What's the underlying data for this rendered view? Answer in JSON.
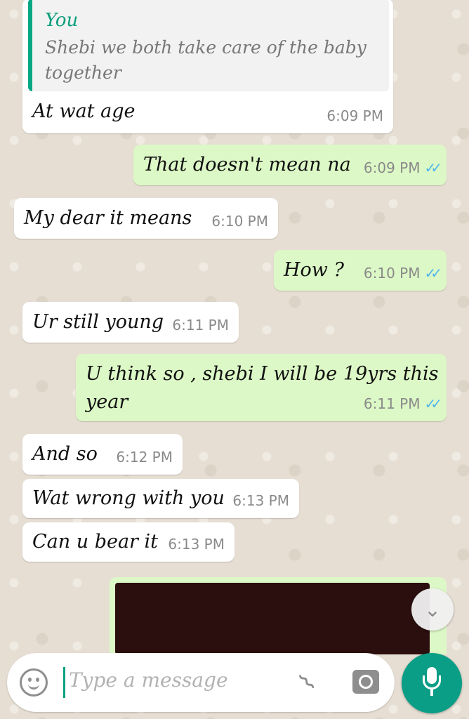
{
  "messages": [
    {
      "kind": "in",
      "text": "At wat age",
      "time": "6:09 PM",
      "reply": {
        "author": "You",
        "text": "Shebi we both take care of the baby together"
      }
    },
    {
      "kind": "out",
      "text": "That doesn't mean na",
      "time": "6:09 PM",
      "ticks": "✓✓"
    },
    {
      "kind": "in",
      "text": "My dear it means",
      "time": "6:10 PM"
    },
    {
      "kind": "out",
      "text": "How ?",
      "time": "6:10 PM",
      "ticks": "✓✓"
    },
    {
      "kind": "in",
      "text": "Ur still young",
      "time": "6:11 PM"
    },
    {
      "kind": "out",
      "text": "U think so , shebi I will be 19yrs this year",
      "line1": "U think so , shebi I will be 19yrs this",
      "line2": "year",
      "time": "6:11 PM",
      "ticks": "✓✓"
    },
    {
      "kind": "in",
      "text": "And so",
      "time": "6:12 PM"
    },
    {
      "kind": "in",
      "text": "Wat wrong with you",
      "time": "6:13 PM"
    },
    {
      "kind": "in",
      "text": "Can u bear it",
      "time": "6:13 PM"
    }
  ],
  "composer": {
    "placeholder": "Type a message"
  },
  "icons": {
    "emoji": "emoji-icon",
    "attach": "paperclip-icon",
    "camera": "camera-icon",
    "mic": "microphone-icon",
    "scroll": "chevron-double-down-icon"
  },
  "colors": {
    "incoming": "#ffffff",
    "outgoing": "#dcf8c6",
    "accent": "#0a9e86",
    "read_ticks": "#4fb6ec"
  }
}
